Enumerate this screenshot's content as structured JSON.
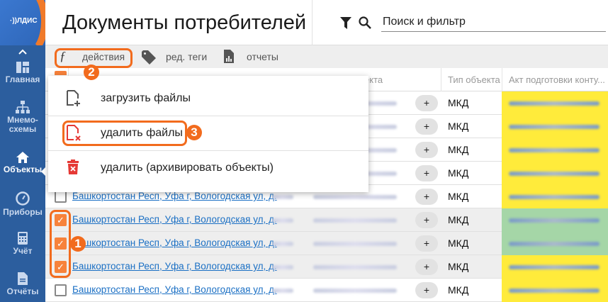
{
  "logo": {
    "text": "ЭЛДИС"
  },
  "sidebar": {
    "items": [
      {
        "label": "Главная",
        "icon": "dashboard-icon"
      },
      {
        "label": "Мнемо-",
        "label2": "схемы",
        "icon": "sitemap-icon"
      },
      {
        "label": "Объекты",
        "icon": "home-icon",
        "active": true
      },
      {
        "label": "Приборы",
        "icon": "gauge-icon"
      },
      {
        "label": "Учёт",
        "icon": "calculator-icon"
      },
      {
        "label": "Отчёты",
        "icon": "document-icon"
      }
    ]
  },
  "header": {
    "title": "Документы потребителей",
    "search_placeholder": "Поиск и фильтр"
  },
  "toolbar": {
    "actions": "действия",
    "edit_tags": "ред. теги",
    "reports": "отчеты"
  },
  "table": {
    "columns": [
      "Адрес объекта",
      "Тип объекта",
      "Акт подготовки конту..."
    ],
    "header_visible_fragment": "екта",
    "rows": [
      {
        "address": "",
        "type": "МКД",
        "checked": false,
        "act_color": "#ffeb3b"
      },
      {
        "address": "",
        "type": "МКД",
        "checked": false,
        "act_color": "#ffeb3b"
      },
      {
        "address": "",
        "type": "МКД",
        "checked": false,
        "act_color": "#ffeb3b"
      },
      {
        "address": "",
        "type": "МКД",
        "checked": false,
        "act_color": "#ffeb3b"
      },
      {
        "address": "Башкортостан Респ, Уфа г, Вологодская ул, д.",
        "type": "МКД",
        "checked": false,
        "act_color": "#ffeb3b"
      },
      {
        "address": "Башкортостан Респ, Уфа г, Вологодская ул, д.",
        "type": "МКД",
        "checked": true,
        "act_color": "#a5d6a7"
      },
      {
        "address": "Башкортостан Респ, Уфа г, Вологодская ул, д.",
        "type": "МКД",
        "checked": true,
        "act_color": "#a5d6a7"
      },
      {
        "address": "Башкортостан Респ, Уфа г, Вологодская ул, д.",
        "type": "МКД",
        "checked": true,
        "act_color": "#ffeb3b"
      },
      {
        "address": "Башкортостан Респ, Уфа г, Вологодская ул, д.",
        "type": "МКД",
        "checked": false,
        "act_color": "#ffeb3b"
      }
    ],
    "add_label": "+"
  },
  "menu": {
    "items": [
      "загрузить файлы",
      "удалить файлы",
      "удалить (архивировать объекты)"
    ]
  },
  "callouts": [
    "1",
    "2",
    "3"
  ],
  "colors": {
    "accent": "#f26b1d",
    "sidebar": "#2c5e9e",
    "link": "#1a6fc4"
  }
}
